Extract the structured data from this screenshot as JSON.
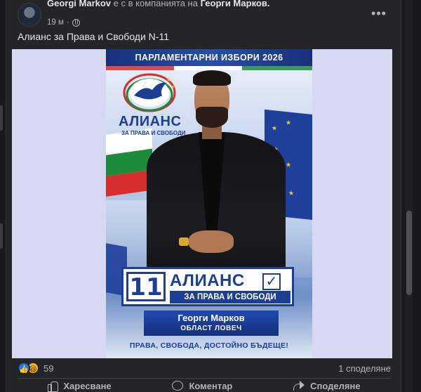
{
  "post": {
    "author": "Georgi Markov",
    "with_text": "е с",
    "coauthor_prefix": "в компанията на",
    "coauthor": "Георги Марков.",
    "time": "19 м",
    "caption": "Алианс за Права и Свободи N-11",
    "more_icon": "more-horizontal-icon"
  },
  "poster": {
    "header": "ПАРЛАМЕНТАРНИ ИЗБОРИ 2026",
    "logo_name": "АЛИАНС",
    "logo_sub": "ЗА ПРАВА И СВОБОДИ",
    "ballot_number": "11",
    "ballot_party": "АЛИАНС",
    "ballot_check": "✓",
    "ballot_sub": "ЗА ПРАВА И СВОБОДИ",
    "candidate_name": "Георги Марков",
    "candidate_region": "ОБЛАСТ ЛОВЕЧ",
    "slogan": "ПРАВА, СВОБОДА, ДОСТОЙНО БЪДЕЩЕ!",
    "colors": {
      "brand_blue": "#1c3f94",
      "flag_white": "#ffffff",
      "flag_green": "#1e8a3b",
      "flag_red": "#d62d2d",
      "eu_blue": "#1e3f9a",
      "eu_star": "#f5cf2a"
    }
  },
  "engagement": {
    "reaction_count": "59",
    "shares": "1 споделяне",
    "like_icon": "👍",
    "haha_icon": "😆"
  },
  "actions": {
    "like": "Харесване",
    "comment": "Коментар",
    "share": "Споделяне"
  }
}
